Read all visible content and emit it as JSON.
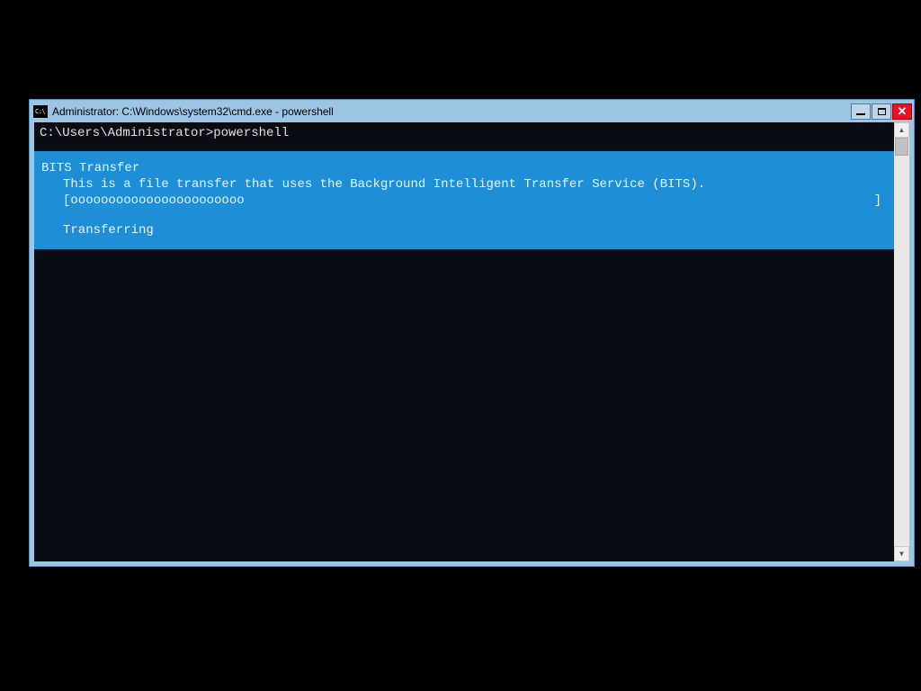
{
  "window": {
    "icon_text": "C:\\",
    "title": "Administrator: C:\\Windows\\system32\\cmd.exe - powershell"
  },
  "terminal": {
    "prompt": "C:\\Users\\Administrator>powershell",
    "progress": {
      "title": "BITS Transfer",
      "description": "This is a file transfer that uses the Background Intelligent Transfer Service (BITS).",
      "bar_open": "[",
      "bar_fill": "ooooooooooooooooooooooo",
      "bar_close": "]",
      "status": "Transferring"
    }
  },
  "colors": {
    "titlebar_bg": "#9bc5e3",
    "terminal_bg": "#0a0e14",
    "progress_bg": "#1e8fd6",
    "close_btn": "#e81123"
  }
}
